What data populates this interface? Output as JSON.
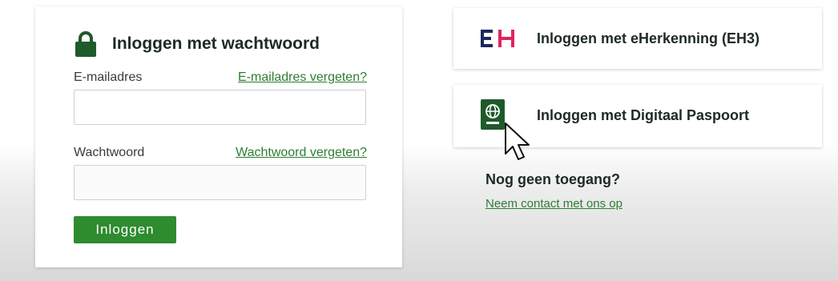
{
  "password_login": {
    "title": "Inloggen met wachtwoord",
    "icon": "lock-icon",
    "email_label": "E-mailadres",
    "email_forgot_link": "E-mailadres vergeten?",
    "email_value": "",
    "password_label": "Wachtwoord",
    "password_forgot_link": "Wachtwoord vergeten?",
    "password_value": "",
    "submit_label": "Inloggen"
  },
  "options": {
    "eherkenning": {
      "label": "Inloggen met eHerkenning (EH3)",
      "icon": "eherkenning-logo"
    },
    "digitaal_paspoort": {
      "label": "Inloggen met Digitaal Paspoort",
      "icon": "passport-icon"
    }
  },
  "no_access": {
    "title": "Nog geen toegang?",
    "contact_link": "Neem contact met ons op"
  },
  "colors": {
    "brand_green": "#2e8b2e",
    "link_green": "#2e7d32",
    "icon_dark_green": "#1f5a2b",
    "eherkenning_pink": "#e0245e",
    "eherkenning_navy": "#1b2a5c"
  }
}
